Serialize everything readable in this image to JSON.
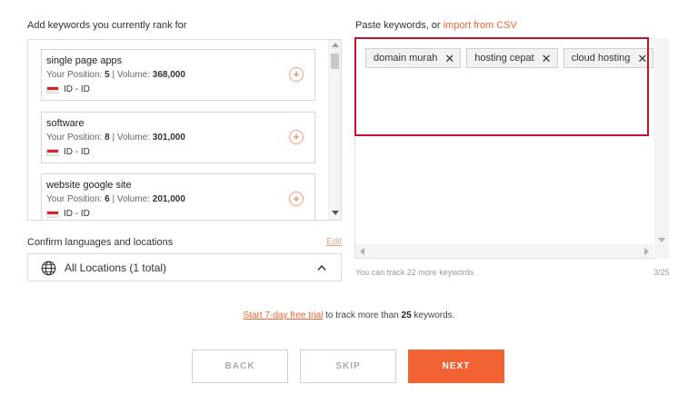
{
  "left": {
    "title": "Add keywords you currently rank for",
    "position_prefix": "Your Position:",
    "volume_prefix": "| Volume:",
    "keywords": [
      {
        "name": "single page apps",
        "position": "5",
        "volume": "368,000",
        "location": "ID - ID"
      },
      {
        "name": "software",
        "position": "8",
        "volume": "301,000",
        "location": "ID - ID"
      },
      {
        "name": "website google site",
        "position": "6",
        "volume": "201,000",
        "location": "ID - ID"
      }
    ],
    "add_symbol": "+"
  },
  "locations": {
    "label": "Confirm languages and locations",
    "edit_label": "Edit",
    "selected": "All Locations (1 total)"
  },
  "right": {
    "title_prefix": "Paste keywords, or ",
    "import_link": "import from CSV",
    "tags": [
      "domain murah",
      "hosting cepat",
      "cloud hosting"
    ],
    "remove_symbol": "✕",
    "track_note": "You can track 22 more keywords",
    "count": "3/25"
  },
  "trial": {
    "link": "Start 7-day free trial",
    "middle": " to track more than ",
    "limit": "25",
    "suffix": " keywords."
  },
  "buttons": {
    "back": "BACK",
    "skip": "SKIP",
    "next": "NEXT"
  },
  "colors": {
    "accent": "#f26334",
    "highlight": "#c8102e"
  }
}
